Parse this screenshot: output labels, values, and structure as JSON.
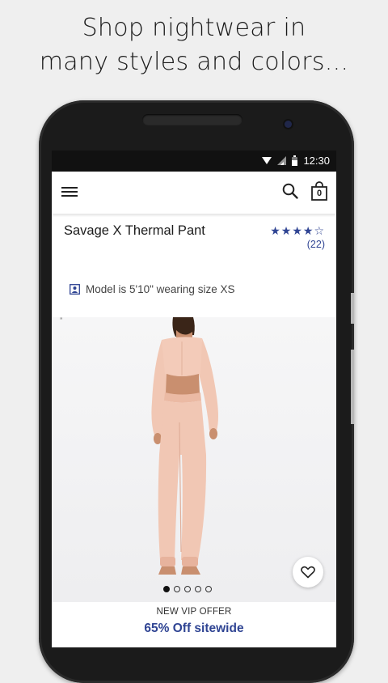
{
  "promo": {
    "line1": "Shop nightwear in",
    "line2": "many styles and colors..."
  },
  "status_bar": {
    "time": "12:30",
    "icons": [
      "wifi-icon",
      "signal-icon",
      "battery-icon"
    ]
  },
  "app_bar": {
    "icons": [
      "menu-icon",
      "search-icon",
      "shopping-bag-icon"
    ],
    "bag_count": "0"
  },
  "product": {
    "title": "Savage X Thermal Pant",
    "stars": "★★★★☆",
    "rating_value": 4,
    "review_count": "(22)",
    "model_note": "Model is 5'10\" wearing size XS",
    "image_alt": "model wearing pink thermal crop top and pants"
  },
  "gallery": {
    "image_count": 5,
    "active_index": 0,
    "mark": "ˮ"
  },
  "offer": {
    "kicker": "NEW VIP OFFER",
    "main": "65% Off sitewide"
  },
  "colors": {
    "accent": "#2f4493",
    "garment": "#f1c7b4",
    "screen_bg": "#ffffff",
    "phone_body": "#1b1b1b"
  }
}
